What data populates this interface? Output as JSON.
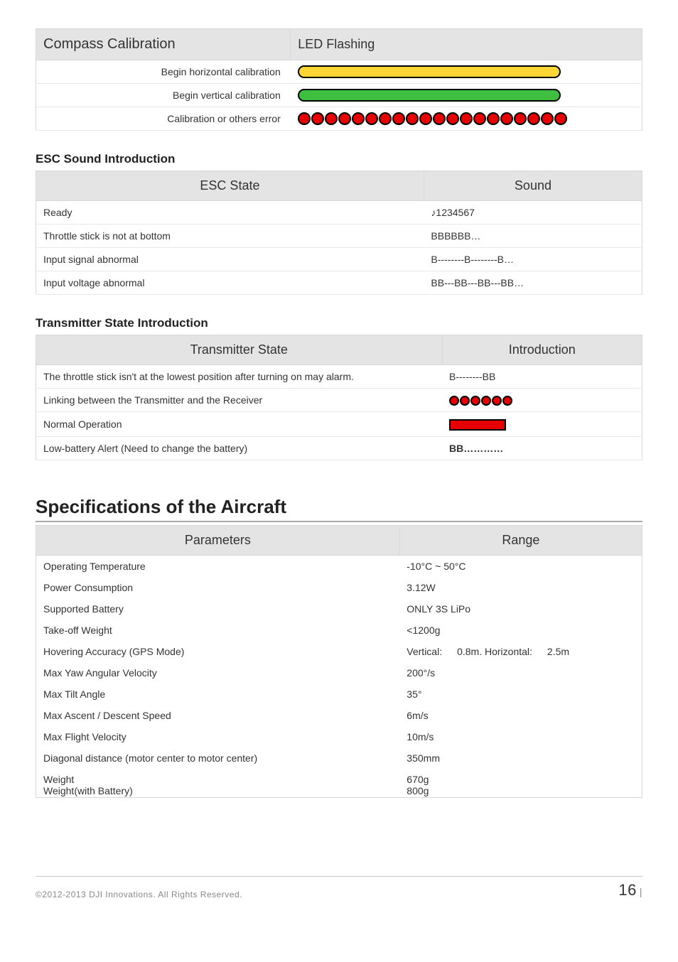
{
  "compass_table": {
    "headers": [
      "Compass Calibration",
      "LED Flashing"
    ],
    "rows": [
      {
        "label": "Begin horizontal calibration",
        "led": {
          "type": "pill",
          "color": "yellow"
        }
      },
      {
        "label": "Begin vertical calibration",
        "led": {
          "type": "pill",
          "color": "green"
        }
      },
      {
        "label": "Calibration or others error",
        "led": {
          "type": "dots",
          "color": "red",
          "count": 20
        }
      }
    ]
  },
  "esc": {
    "heading": "ESC Sound Introduction",
    "headers": [
      "ESC State",
      "Sound"
    ],
    "rows": [
      {
        "state": "Ready",
        "sound": "♪1234567"
      },
      {
        "state": "Throttle stick is not at bottom",
        "sound": "BBBBBB…"
      },
      {
        "state": "Input signal abnormal",
        "sound": "B--------B--------B…"
      },
      {
        "state": "Input voltage abnormal",
        "sound": "BB---BB---BB---BB…"
      }
    ]
  },
  "tx": {
    "heading": "Transmitter State Introduction",
    "headers": [
      "Transmitter State",
      "Introduction"
    ],
    "rows": [
      {
        "state": "The throttle stick isn't at the lowest position after turning on may alarm.",
        "intro_text": "B--------BB"
      },
      {
        "state": "Linking between the Transmitter and the Receiver",
        "intro_led": {
          "type": "smalldots",
          "color": "red",
          "count": 6
        }
      },
      {
        "state": "Normal Operation",
        "intro_led": {
          "type": "bar",
          "color": "red"
        }
      },
      {
        "state": "Low-battery Alert (Need to change the battery)",
        "intro_text": "BB…………",
        "bold": true
      }
    ]
  },
  "spec": {
    "heading": "Specifications of the Aircraft",
    "headers": [
      "Parameters",
      "Range"
    ],
    "rows": [
      {
        "param": "Operating Temperature",
        "range": "-10°C ~ 50°C"
      },
      {
        "param": "Power Consumption",
        "range": "3.12W"
      },
      {
        "param": "Supported Battery",
        "range": "ONLY 3S LiPo"
      },
      {
        "param": "Take-off Weight",
        "range": "<1200g"
      },
      {
        "param": "Hovering Accuracy (GPS Mode)",
        "range": "Vertical:  0.8m. Horizontal:  2.5m"
      },
      {
        "param": "Max Yaw Angular Velocity",
        "range": "200°/s"
      },
      {
        "param": "Max Tilt Angle",
        "range": "35°"
      },
      {
        "param": "Max Ascent / Descent Speed",
        "range": "6m/s"
      },
      {
        "param": "Max Flight Velocity",
        "range": "10m/s"
      },
      {
        "param": "Diagonal distance (motor center to motor center)",
        "range": "350mm"
      }
    ],
    "weight_row": {
      "param1": "Weight",
      "range1": "670g",
      "param2": "Weight(with Battery)",
      "range2": "800g"
    }
  },
  "footer": {
    "copyright": "©2012-2013 DJI Innovations. All Rights Reserved.",
    "page": "16",
    "sep": "|"
  }
}
